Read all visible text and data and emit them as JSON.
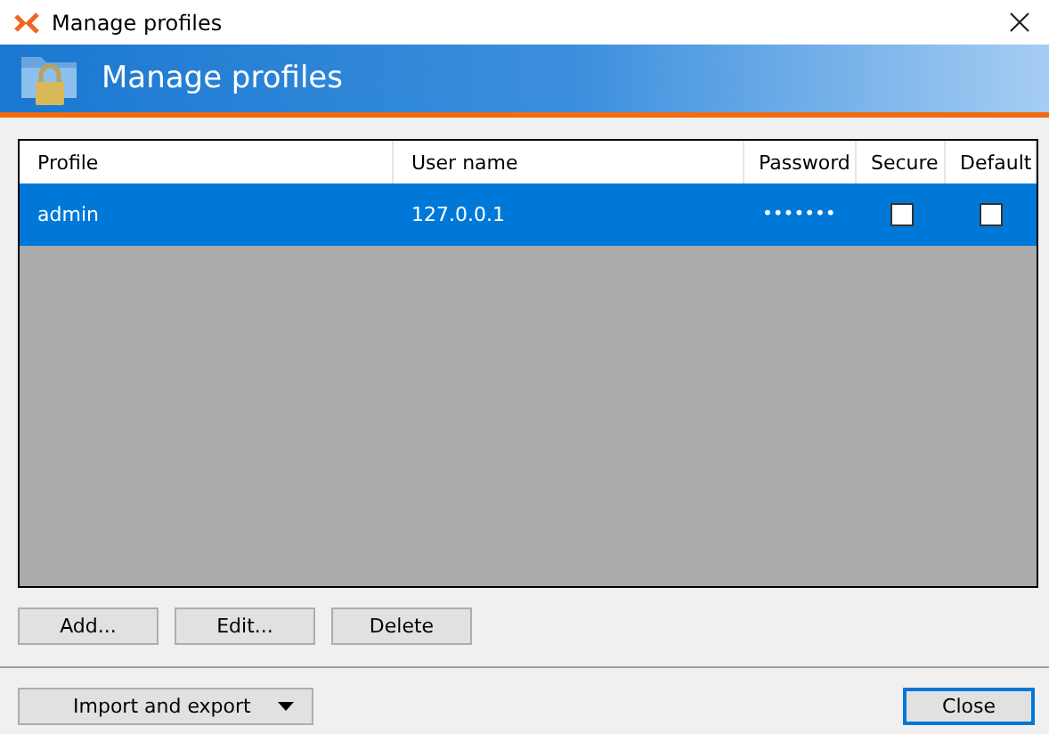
{
  "window": {
    "title": "Manage profiles"
  },
  "banner": {
    "title": "Manage profiles"
  },
  "table": {
    "columns": [
      "Profile",
      "User name",
      "Password",
      "Secure",
      "Default"
    ],
    "rows": [
      {
        "profile": "admin",
        "user_name": "127.0.0.1",
        "password": "•••••••",
        "secure": false,
        "default": false,
        "selected": true
      }
    ]
  },
  "buttons": [
    "Add...",
    "Edit...",
    "Delete"
  ],
  "footer": {
    "menu_button": "Import and export",
    "close_button": "Close"
  }
}
